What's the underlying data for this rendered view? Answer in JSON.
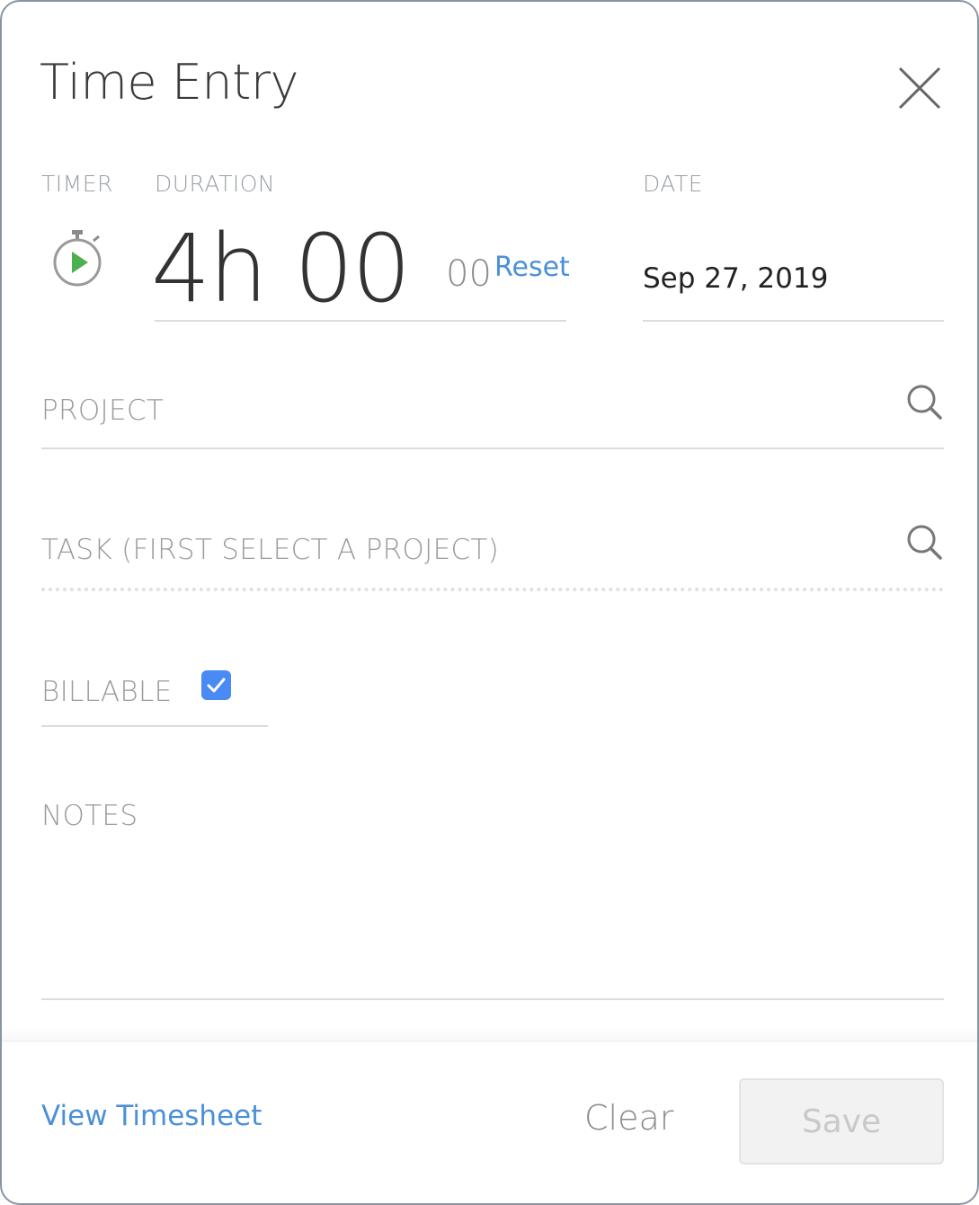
{
  "dialog": {
    "title": "Time Entry"
  },
  "labels": {
    "timer": "TIMER",
    "duration": "DURATION",
    "date": "DATE"
  },
  "duration": {
    "main": "4h 00",
    "seconds": "00",
    "reset_label": "Reset"
  },
  "date": {
    "value": "Sep 27, 2019"
  },
  "fields": {
    "project_placeholder": "PROJECT",
    "task_placeholder": "TASK (FIRST SELECT A PROJECT)",
    "billable_label": "BILLABLE",
    "billable_checked": true,
    "notes_placeholder": "NOTES"
  },
  "footer": {
    "view_timesheet": "View Timesheet",
    "clear": "Clear",
    "save": "Save"
  },
  "colors": {
    "accent_blue": "#4a90d9",
    "checkbox_blue": "#4a8af4",
    "play_green": "#4caf50"
  },
  "icons": {
    "close": "close-icon",
    "timer": "stopwatch-play-icon",
    "search": "search-icon",
    "check": "check-icon"
  }
}
